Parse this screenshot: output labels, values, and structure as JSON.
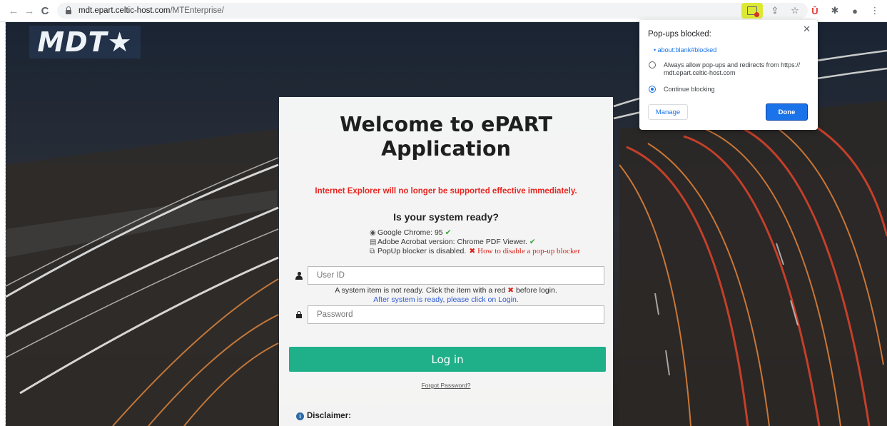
{
  "browser": {
    "url_host": "mdt.epart.celtic-host.com",
    "url_path": "/MTEnterprise/",
    "nav_back": "←",
    "nav_forward": "→",
    "nav_reload": "C"
  },
  "brand": {
    "logo_text": "MDT★"
  },
  "login": {
    "welcome_line1": "Welcome to ePART",
    "welcome_line2": "Application",
    "ie_warning": "Internet Explorer will no longer be supported effective immediately.",
    "ready_title": "Is your system ready?",
    "checks": [
      {
        "label": "Google Chrome: 95",
        "status": "ok"
      },
      {
        "label": "Adobe Acrobat version: Chrome PDF Viewer.",
        "status": "ok"
      },
      {
        "label": "PopUp blocker is disabled.",
        "status": "bad",
        "help": "How to disable a pop-up blocker"
      }
    ],
    "user_placeholder": "User ID",
    "password_placeholder": "Password",
    "not_ready_msg_a": "A system item is not ready. Click the item with a red",
    "not_ready_msg_b": "before login.",
    "after_ready_msg": "After system is ready, please click on Login.",
    "login_button": "Log in",
    "forgot_password": "Forgot Password?",
    "disclaimer_label": "Disclaimer:"
  },
  "popup_bubble": {
    "title": "Pop-ups blocked:",
    "blocked_link": "about:blank#blocked",
    "option_allow": "Always allow pop-ups and redirects from https://",
    "option_allow_line2": "mdt.epart.celtic-host.com",
    "option_block": "Continue blocking",
    "selected": "Continue blocking",
    "manage_button": "Manage",
    "done_button": "Done"
  },
  "colors": {
    "login_button": "#1fb08a",
    "warning": "#e8261f",
    "link_blue": "#1a73e8",
    "popup_icon_highlight": "#dde834"
  }
}
